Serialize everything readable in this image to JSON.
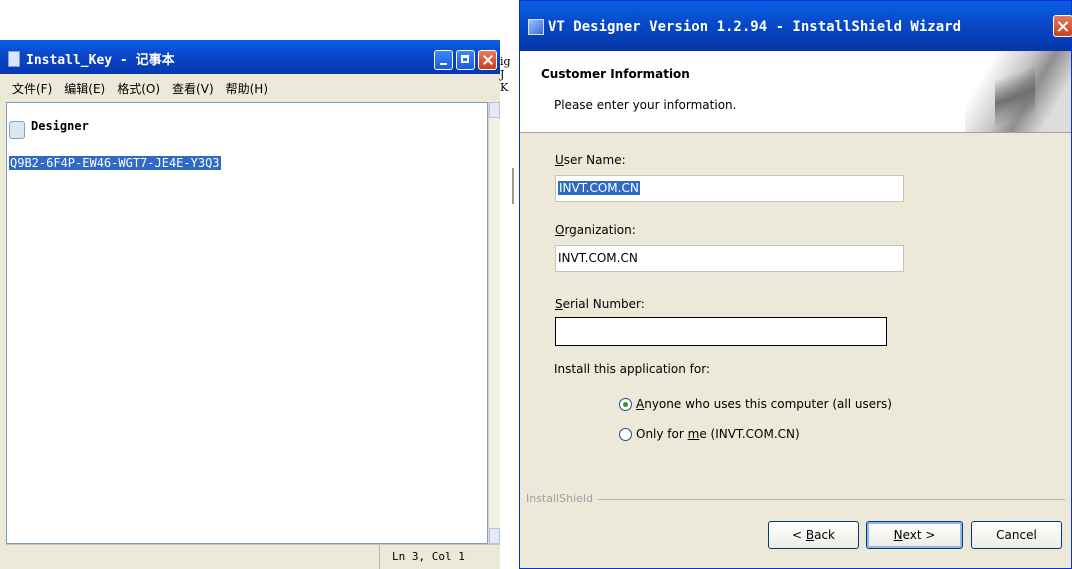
{
  "notepad": {
    "title": "Install_Key - 记事本",
    "menu": [
      "文件(F)",
      "编辑(E)",
      "格式(O)",
      "查看(V)",
      "帮助(H)"
    ],
    "line1": "Designer",
    "selected_line": "Q9B2-6F4P-EW46-WGT7-JE4E-Y3Q3",
    "status_position": "Ln 3, Col 1"
  },
  "background_window": {
    "fragments": [
      "ig",
      "J",
      "K"
    ]
  },
  "wizard": {
    "title": "VT Designer Version 1.2.94 - InstallShield Wizard",
    "heading": "Customer Information",
    "subheading": "Please enter your information.",
    "user_name_label_mnemonic": "U",
    "user_name_label_rest": "ser Name:",
    "user_name_value": "INVT.COM.CN",
    "organization_label_mnemonic": "O",
    "organization_label_rest": "rganization:",
    "organization_value": "INVT.COM.CN",
    "serial_label_mnemonic": "S",
    "serial_label_rest": "erial Number:",
    "serial_value": "",
    "install_for_label": "Install this application for:",
    "option_all_mnemonic": "A",
    "option_all_rest": "nyone who uses this computer (all users)",
    "option_me_pre": "Only for ",
    "option_me_mnemonic": "m",
    "option_me_rest": "e (INVT.COM.CN)",
    "brand": "InstallShield",
    "back_pre": "< ",
    "back_mnemonic": "B",
    "back_rest": "ack",
    "next_mnemonic": "N",
    "next_rest": "ext >",
    "cancel_label": "Cancel",
    "selected_option": "all_users"
  }
}
